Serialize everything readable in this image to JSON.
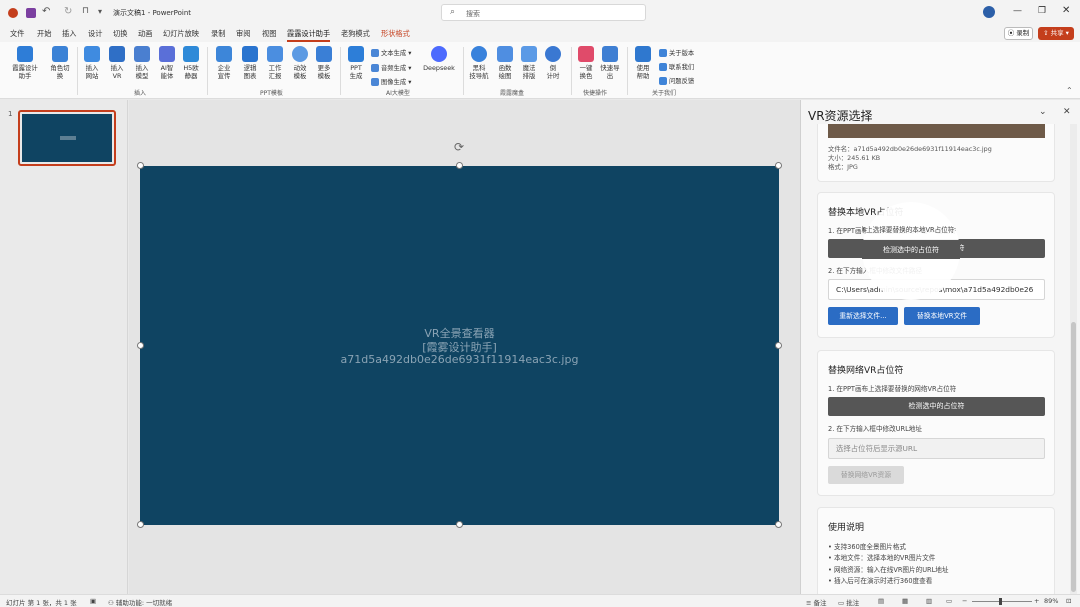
{
  "title": {
    "doc_name": "演示文稿1",
    "app_name": "PowerPoint",
    "search_placeholder": "搜索"
  },
  "menu_tabs": [
    "文件",
    "开始",
    "插入",
    "设计",
    "切换",
    "动画",
    "幻灯片放映",
    "录制",
    "审阅",
    "视图",
    "霞露设计助手",
    "老狗模式",
    "形状格式"
  ],
  "right_buttons": {
    "record": "录制",
    "share": "共享"
  },
  "ribbon": {
    "big_buttons": [
      "霞露设计\n助手",
      "角色切\n换",
      "插入\n网站",
      "插入\nVR",
      "插入\n模型",
      "AI智\n能体",
      "H5欧\n静器",
      "企业\n宣传",
      "逻辑\n图表",
      "工作\n汇报",
      "动效\n模板",
      "更多\n模板",
      "PPT\n生成",
      "Deepseek",
      "黑科\n技导航",
      "函数\n绘图",
      "魔法\n排版",
      "倒\n计时",
      "一键\n换色",
      "快速导\n出",
      "使用\n帮助"
    ],
    "ai_small": [
      "文本生成",
      "音频生成",
      "图像生成"
    ],
    "about_small": [
      "关于版本",
      "联系我们",
      "问题反馈"
    ],
    "groups": [
      "插入",
      "PPT模板",
      "AI大模型",
      "霞露魔盒",
      "快捷操作",
      "关于我们"
    ]
  },
  "thumbnail": {
    "number": "1"
  },
  "slide": {
    "line1": "VR全景查看器",
    "line2": "[霞雾设计助手]",
    "line3": "a71d5a492db0e26de6931f11914eac3c.jpg"
  },
  "task_pane": {
    "title": "VR资源选择",
    "file_info": {
      "name": "文件名：a71d5a492db0e26de6931f11914eac3c.jpg",
      "size": "大小：245.61 KB",
      "format": "格式：JPG"
    },
    "local": {
      "heading": "替换本地VR占位符",
      "step1": "1. 在PPT画布上选择要替换的本地VR占位符",
      "detect_button": "检测选中的占位符",
      "step2": "2. 在下方输入框中修改文件路径",
      "path_value": "C:\\Users\\admin\\source\\repos\\mox\\a71d5a492db0e26",
      "reselect_button": "重新选择文件...",
      "replace_button": "替换本地VR文件"
    },
    "network": {
      "heading": "替换网络VR占位符",
      "step1": "1. 在PPT画布上选择要替换的网络VR占位符",
      "detect_button": "检测选中的占位符",
      "step2": "2. 在下方输入框中修改URL地址",
      "url_placeholder": "选择占位符后显示源URL",
      "replace_button": "替换网络VR资源"
    },
    "help": {
      "heading": "使用说明",
      "items": [
        "• 支持360度全景图片格式",
        "• 本地文件：选择本地的VR图片文件",
        "• 网络资源：输入在线VR图片的URL地址",
        "• 插入后可在演示时进行360度查看"
      ]
    }
  },
  "status": {
    "slide_info": "幻灯片 第 1 张，共 1 张",
    "accessibility": "辅助功能: 一切就绪",
    "notes": "备注",
    "comments": "批注",
    "zoom": "89%"
  },
  "colors": {
    "slide_bg": "#0f4462",
    "accent": "#c43e1c",
    "blue_button": "#2b6cc4",
    "dark_button": "#565656"
  }
}
